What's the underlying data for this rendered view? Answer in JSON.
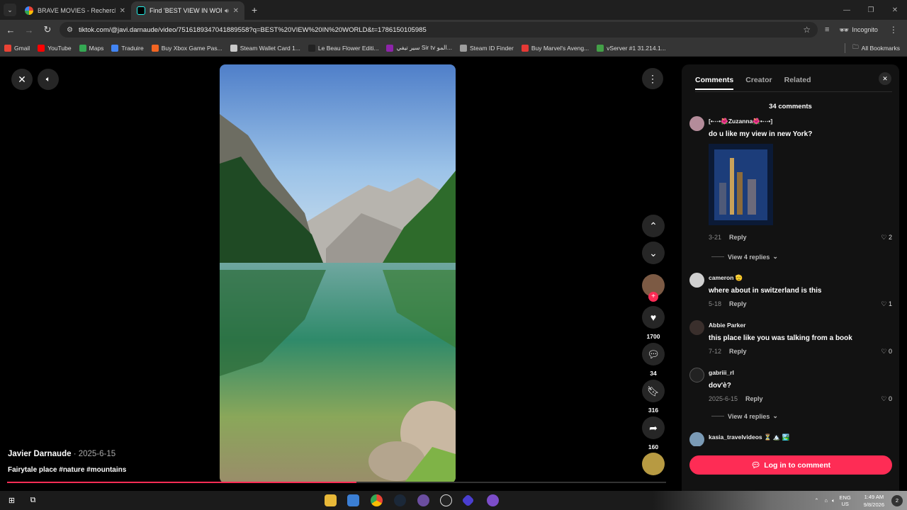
{
  "browser": {
    "tabs": [
      {
        "title": "BRAVE MOVIES - Recherche Go",
        "favicon": "google-icon",
        "active": false
      },
      {
        "title": "Find 'BEST VIEW IN WORLD'",
        "favicon": "tiktok-icon",
        "active": true
      }
    ],
    "url": "tiktok.com/@javi.darnaude/video/7516189347041889558?q=BEST%20VIEW%20IN%20WORLD&t=1786150105985",
    "incognito_label": "Incognito",
    "bookmarks": [
      {
        "label": "Gmail",
        "color": "#ea4335"
      },
      {
        "label": "YouTube",
        "color": "#ff0000"
      },
      {
        "label": "Maps",
        "color": "#34a853"
      },
      {
        "label": "Traduire",
        "color": "#4285f4"
      },
      {
        "label": "Buy Xbox Game Pas...",
        "color": "#f26522"
      },
      {
        "label": "Steam Wallet Card 1...",
        "color": "#c9c9c9"
      },
      {
        "label": "Le Beau Flower Editi...",
        "color": "#222222"
      },
      {
        "label": "سير تيفي Sir tv المو...",
        "color": "#8e24aa"
      },
      {
        "label": "Steam ID Finder",
        "color": "#9e9e9e"
      },
      {
        "label": "Buy Marvel's Aveng...",
        "color": "#e53935"
      },
      {
        "label": "vServer #1 31.214.1...",
        "color": "#43a047"
      }
    ],
    "all_bookmarks": "All Bookmarks"
  },
  "video": {
    "author": "Javier Darnaude",
    "date": " · 2025-6-15",
    "caption": "Fairytale place #nature #mountains",
    "progress": 0.53
  },
  "actions": {
    "likes": "1700",
    "comments": "34",
    "saves": "316",
    "shares": "160"
  },
  "panel": {
    "tabs": [
      "Comments",
      "Creator",
      "Related"
    ],
    "count": "34 comments",
    "comments": [
      {
        "user": "[•⋯•🌺Zuzanna🌺•⋯•]",
        "text": "do u like my view in new York?",
        "date": "3-21",
        "likes": "2",
        "replies": "View 4 replies"
      },
      {
        "user": "cameron 🫡",
        "text": "where about in switzerland is this",
        "date": "5-18",
        "likes": "1"
      },
      {
        "user": "Abbie Parker",
        "text": "this place like you was talking from a book",
        "date": "7-12",
        "likes": "0"
      },
      {
        "user": "gabriii_rl",
        "text": "dov'è?",
        "date": "2025-6-15",
        "likes": "0",
        "replies": "View 4 replies"
      },
      {
        "user": "kasia_travelvideos ⏳ 🏔️ 🏞️"
      }
    ],
    "reply_label": "Reply",
    "login_label": "Log in to comment"
  },
  "taskbar": {
    "lang_top": "ENG",
    "lang_bottom": "US",
    "time": "1:49 AM",
    "date": "9/8/2026",
    "notif": "2"
  }
}
